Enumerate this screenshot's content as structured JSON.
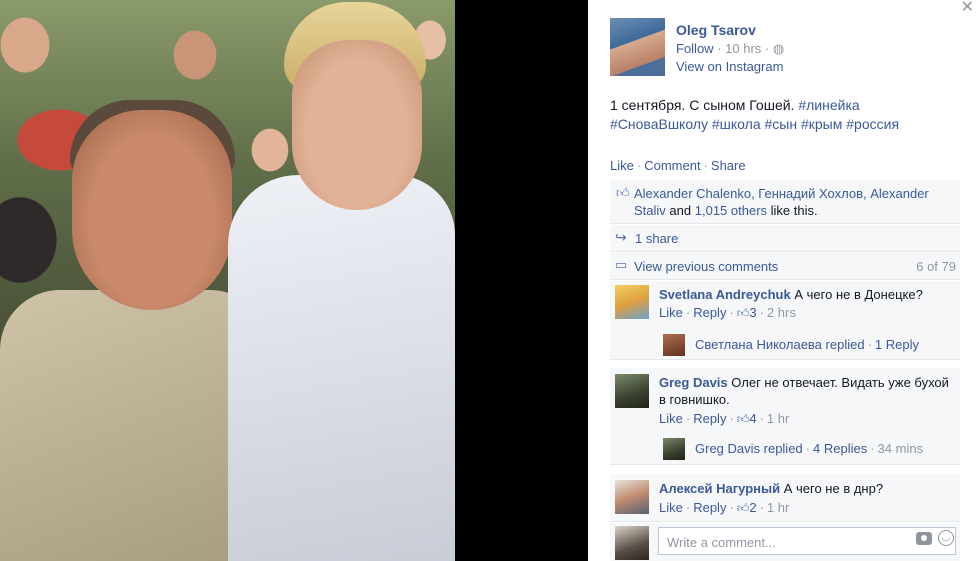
{
  "post": {
    "author": "Oleg Tsarov",
    "follow_label": "Follow",
    "time": "10 hrs",
    "privacy_icon": "globe-icon",
    "view_on_instagram": "View on Instagram",
    "caption_text": "1 сентября. С сыном Гошей.",
    "hashtags_line1": [
      "#линейка"
    ],
    "hashtags_line2": [
      "#СноваВшколу",
      "#школа",
      "#сын",
      "#крым",
      "#россия"
    ]
  },
  "actions": {
    "like": "Like",
    "comment": "Comment",
    "share": "Share"
  },
  "likes": {
    "names": "Alexander Chalenko, Геннадий Хохлов, Alexander Staliv",
    "and": "and",
    "others": "1,015 others",
    "suffix": "like this."
  },
  "shares": {
    "label": "1 share"
  },
  "comments_nav": {
    "view_previous": "View previous comments",
    "count": "6 of 79"
  },
  "comments": [
    {
      "author": "Svetlana Andreychuk",
      "text": "А чего не в Донецке?",
      "like": "Like",
      "reply": "Reply",
      "likes": "3",
      "time": "2 hrs",
      "reply_summary": {
        "who": "Светлана Николаева replied",
        "count": "1 Reply",
        "time": ""
      }
    },
    {
      "author": "Greg Davis",
      "text": "Олег не отвечает. Видать уже бухой в говнишко.",
      "like": "Like",
      "reply": "Reply",
      "likes": "4",
      "time": "1 hr",
      "reply_summary": {
        "who": "Greg Davis replied",
        "count": "4 Replies",
        "time": "34 mins"
      }
    },
    {
      "author": "Алексей Нагурный",
      "text": "А чего не в днр?",
      "like": "Like",
      "reply": "Reply",
      "likes": "2",
      "time": "1 hr"
    }
  ],
  "composer": {
    "placeholder": "Write a comment...",
    "camera_icon": "camera-icon",
    "emoji_icon": "emoji-icon"
  },
  "colors": {
    "link": "#3b5998",
    "meta": "#9197a3",
    "panel_bg": "#f6f7f9"
  }
}
